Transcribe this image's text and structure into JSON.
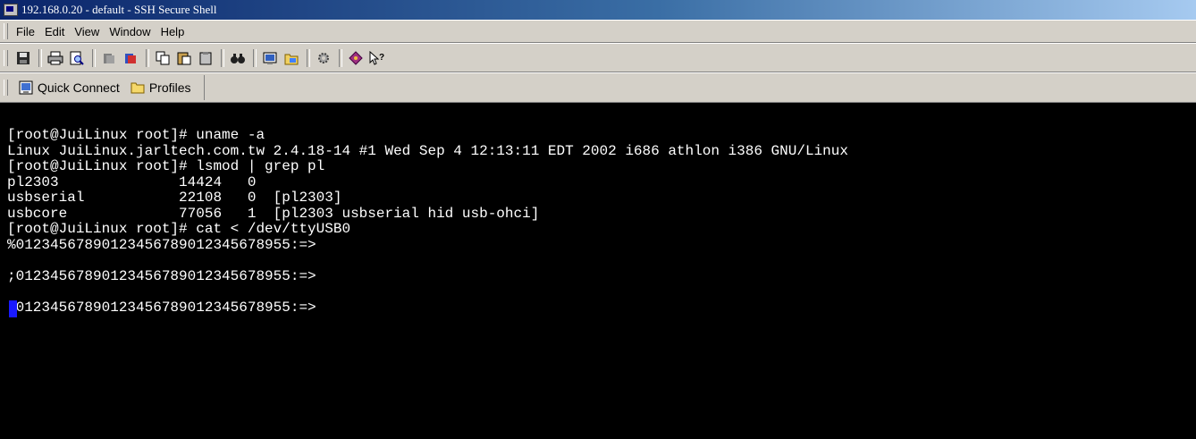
{
  "window": {
    "title": "192.168.0.20 - default - SSH Secure Shell",
    "icon": "ssh-terminal-icon"
  },
  "menu": {
    "items": [
      {
        "label": "File",
        "name": "file"
      },
      {
        "label": "Edit",
        "name": "edit"
      },
      {
        "label": "View",
        "name": "view"
      },
      {
        "label": "Window",
        "name": "window"
      },
      {
        "label": "Help",
        "name": "help"
      }
    ]
  },
  "toolbar": {
    "buttons": [
      {
        "icon": "save-icon"
      },
      {
        "icon": "print-icon"
      },
      {
        "icon": "print-preview-icon"
      },
      {
        "icon": "disconnect-icon"
      },
      {
        "icon": "connect-icon"
      },
      {
        "icon": "copy-icon"
      },
      {
        "icon": "paste-icon"
      },
      {
        "icon": "paste-clipboard-icon"
      },
      {
        "icon": "find-icon"
      },
      {
        "icon": "new-terminal-icon"
      },
      {
        "icon": "file-transfer-icon"
      },
      {
        "icon": "settings-icon"
      },
      {
        "icon": "keygen-icon"
      },
      {
        "icon": "context-help-icon"
      }
    ]
  },
  "quickbar": {
    "quick_connect_label": "Quick Connect",
    "profiles_label": "Profiles"
  },
  "terminal": {
    "lines": [
      "[root@JuiLinux root]# uname -a",
      "Linux JuiLinux.jarltech.com.tw 2.4.18-14 #1 Wed Sep 4 12:13:11 EDT 2002 i686 athlon i386 GNU/Linux",
      "[root@JuiLinux root]# lsmod | grep pl",
      "pl2303              14424   0",
      "usbserial           22108   0  [pl2303]",
      "usbcore             77056   1  [pl2303 usbserial hid usb-ohci]",
      "[root@JuiLinux root]# cat < /dev/ttyUSB0",
      "%0123456789012345678901234567895​5:=>",
      "",
      ";0123456789012345678901234567895​5:=>",
      "",
      ";0123456789012345678901234567895​5:=>"
    ],
    "cursor_color": "#1a1aff"
  },
  "colors": {
    "titlebar_start": "#0a246a",
    "titlebar_end": "#a6caf0",
    "chrome": "#d4d0c8",
    "terminal_bg": "#000000",
    "terminal_fg": "#ffffff"
  }
}
